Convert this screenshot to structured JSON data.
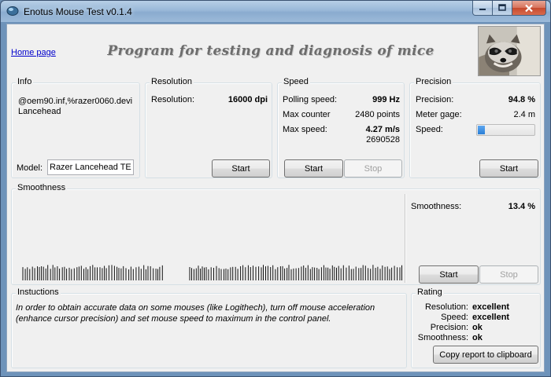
{
  "window": {
    "title": "Enotus Mouse Test v0.1.4"
  },
  "header": {
    "home_link": "Home page",
    "banner": "Program for testing and diagnosis of mice"
  },
  "info": {
    "legend": "Info",
    "device_id": "@oem90.inf,%razer0060.devi Lancehead",
    "model_label": "Model:",
    "model_value": "Razer Lancehead TE"
  },
  "resolution": {
    "legend": "Resolution",
    "label": "Resolution:",
    "value": "16000 dpi",
    "start_label": "Start"
  },
  "speed": {
    "legend": "Speed",
    "polling_label": "Polling speed:",
    "polling_value": "999 Hz",
    "counter_label": "Max counter",
    "counter_value": "2480 points",
    "max_speed_label": "Max  speed:",
    "max_speed_value": "4.27 m/s",
    "max_speed_sub": "2690528",
    "start_label": "Start",
    "stop_label": "Stop"
  },
  "precision": {
    "legend": "Precision",
    "precision_label": "Precision:",
    "precision_value": "94.8 %",
    "meter_label": "Meter gage:",
    "meter_value": "2.4 m",
    "speed_label": "Speed:",
    "speed_level": 0.13,
    "start_label": "Start"
  },
  "smoothness": {
    "legend": "Smoothness",
    "label": "Smoothness:",
    "value": "13.4 %",
    "start_label": "Start",
    "stop_label": "Stop"
  },
  "instructions": {
    "legend": "Instuctions",
    "text": "In order to obtain accurate data on some mouses (like Logithech), turn off mouse acceleration (enhance cursor precision) and set mouse speed to maximum in the control panel."
  },
  "rating": {
    "legend": "Rating",
    "rows": [
      {
        "label": "Resolution:",
        "value": "excellent"
      },
      {
        "label": "Speed:",
        "value": "excellent"
      },
      {
        "label": "Precision:",
        "value": "ok"
      },
      {
        "label": "Smoothness:",
        "value": "ok"
      }
    ],
    "copy_label": "Copy report to clipboard"
  },
  "colors": {
    "progress_fill": "#2a7fd6",
    "link": "#0000cc",
    "banner": "#6d6d6d"
  }
}
